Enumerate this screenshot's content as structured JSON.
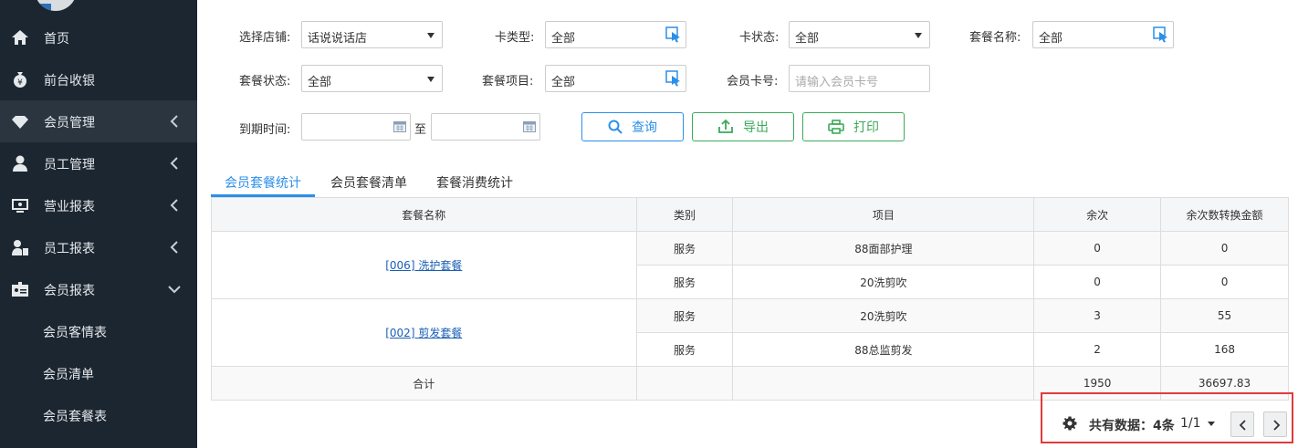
{
  "sidebar": {
    "items": [
      {
        "label": "首页"
      },
      {
        "label": "前台收银"
      },
      {
        "label": "会员管理"
      },
      {
        "label": "员工管理"
      },
      {
        "label": "营业报表"
      },
      {
        "label": "员工报表"
      },
      {
        "label": "会员报表"
      }
    ],
    "sub_items": [
      {
        "label": "会员客情表"
      },
      {
        "label": "会员清单"
      },
      {
        "label": "会员套餐表"
      }
    ]
  },
  "filters": {
    "store": {
      "label": "选择店铺:",
      "value": "话说说话店"
    },
    "card_type": {
      "label": "卡类型:",
      "value": "全部"
    },
    "card_status": {
      "label": "卡状态:",
      "value": "全部"
    },
    "package_name": {
      "label": "套餐名称:",
      "value": "全部"
    },
    "package_status": {
      "label": "套餐状态:",
      "value": "全部"
    },
    "package_item": {
      "label": "套餐项目:",
      "value": "全部"
    },
    "member_card": {
      "label": "会员卡号:",
      "placeholder": "请输入会员卡号"
    },
    "expiry": {
      "label": "到期时间:",
      "separator": "至"
    }
  },
  "actions": {
    "query": "查询",
    "export": "导出",
    "print": "打印"
  },
  "tabs": [
    {
      "label": "会员套餐统计"
    },
    {
      "label": "会员套餐清单"
    },
    {
      "label": "套餐消费统计"
    }
  ],
  "table": {
    "headers": [
      "套餐名称",
      "类别",
      "项目",
      "余次",
      "余次数转换金额"
    ],
    "groups": [
      {
        "name": "[006] 洗护套餐",
        "rows": [
          {
            "category": "服务",
            "item": "88面部护理",
            "remaining": "0",
            "amount": "0"
          },
          {
            "category": "服务",
            "item": "20洗剪吹",
            "remaining": "0",
            "amount": "0"
          }
        ]
      },
      {
        "name": "[002] 剪发套餐",
        "rows": [
          {
            "category": "服务",
            "item": "20洗剪吹",
            "remaining": "3",
            "amount": "55"
          },
          {
            "category": "服务",
            "item": "88总监剪发",
            "remaining": "2",
            "amount": "168"
          }
        ]
      }
    ],
    "total": {
      "label": "合计",
      "remaining": "1950",
      "amount": "36697.83"
    }
  },
  "pager": {
    "summary": "共有数据：4条",
    "page": "1/1"
  },
  "colors": {
    "sidebar_bg": "#1b2630",
    "primary": "#2b8fe8",
    "success": "#3aaa59",
    "highlight_border": "#e03b3b"
  }
}
